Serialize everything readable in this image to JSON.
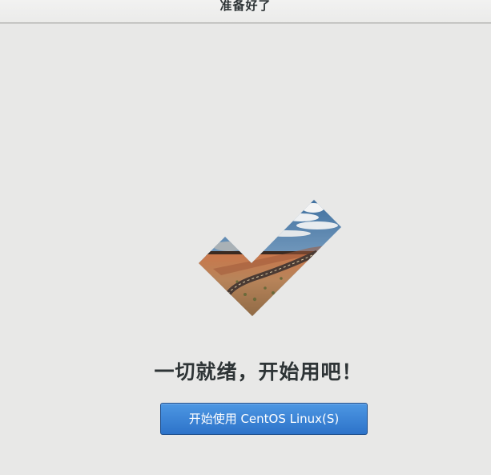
{
  "window": {
    "title": "准备好了"
  },
  "main": {
    "heading": "一切就绪，开始用吧！",
    "start_button_label": "开始使用 CentOS Linux(S)"
  },
  "icons": {
    "check": "checkmark-landscape-icon"
  },
  "colors": {
    "background": "#e8e8e7",
    "button_top": "#4d97e3",
    "button_bottom": "#2d73c9",
    "text": "#2e3436"
  }
}
